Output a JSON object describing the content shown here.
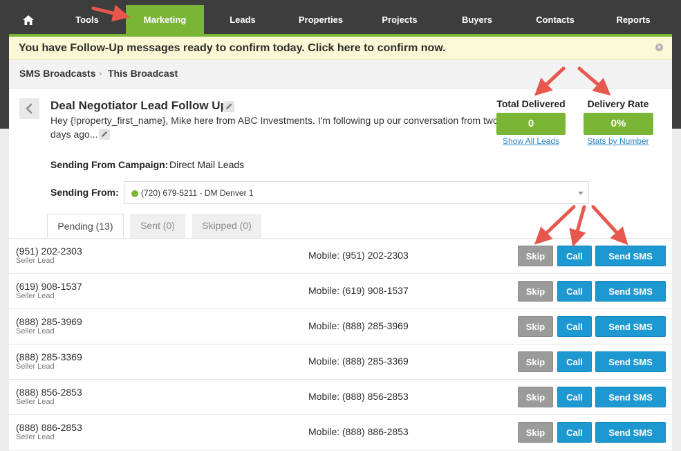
{
  "nav": {
    "home_icon": "home-icon",
    "items": [
      {
        "label": "Tools"
      },
      {
        "label": "Marketing"
      },
      {
        "label": "Leads"
      },
      {
        "label": "Properties"
      },
      {
        "label": "Projects"
      },
      {
        "label": "Buyers"
      },
      {
        "label": "Contacts"
      },
      {
        "label": "Reports"
      }
    ],
    "active": "Marketing",
    "accent_color": "#7ab535"
  },
  "banner": {
    "text": "You have Follow-Up messages ready to confirm today. Click here to confirm now.",
    "close_icon": "close-icon"
  },
  "breadcrumb": {
    "items": [
      "SMS Broadcasts",
      "This Broadcast"
    ],
    "separator": "›"
  },
  "broadcast": {
    "title": "Deal Negotiator Lead Follow Up",
    "message": "Hey {!property_first_name}, Mike here from ABC Investments. I'm following up our conversation from two days ago...",
    "campaign_label": "Sending From Campaign:",
    "campaign_value": "Direct Mail Leads",
    "from_label": "Sending From:",
    "from_value": "(720) 679-5211 - DM Denver 1"
  },
  "stats": {
    "total_delivered_label": "Total Delivered",
    "total_delivered_value": "0",
    "total_delivered_link": "Show All Leads",
    "delivery_rate_label": "Delivery Rate",
    "delivery_rate_value": "0%",
    "delivery_rate_link": "Stats by Number"
  },
  "tabs": [
    {
      "label": "Pending (13)",
      "active": true
    },
    {
      "label": "Sent (0)",
      "active": false
    },
    {
      "label": "Skipped (0)",
      "active": false
    }
  ],
  "actions": {
    "skip": "Skip",
    "call": "Call",
    "send_sms": "Send SMS"
  },
  "rows": [
    {
      "phone": "(951) 202-2303",
      "type": "Seller Lead",
      "mobile": "Mobile: (951) 202-2303"
    },
    {
      "phone": "(619) 908-1537",
      "type": "Seller Lead",
      "mobile": "Mobile: (619) 908-1537"
    },
    {
      "phone": "(888) 285-3969",
      "type": "Seller Lead",
      "mobile": "Mobile: (888) 285-3969"
    },
    {
      "phone": "(888) 285-3369",
      "type": "Seller Lead",
      "mobile": "Mobile: (888) 285-3369"
    },
    {
      "phone": "(888) 856-2853",
      "type": "Seller Lead",
      "mobile": "Mobile: (888) 856-2853"
    },
    {
      "phone": "(888) 886-2853",
      "type": "Seller Lead",
      "mobile": "Mobile: (888) 886-2853"
    }
  ]
}
